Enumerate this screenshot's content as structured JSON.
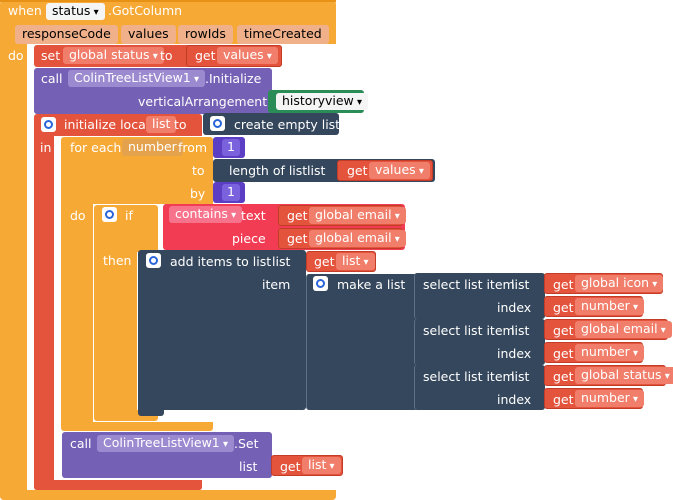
{
  "event": {
    "when": "when",
    "component": "status",
    "event_name": ".GotColumn",
    "do": "do",
    "params": [
      "responseCode",
      "values",
      "rowIds",
      "timeCreated"
    ]
  },
  "set_status": {
    "set": "set",
    "var": "global status",
    "to": "to",
    "get": "get",
    "value": "values"
  },
  "init_call": {
    "call": "call",
    "component": "ColinTreeListView1",
    "method": ".Initialize",
    "arg_label": "verticalArrangement",
    "arg_value": "historyview"
  },
  "local": {
    "label": "initialize local",
    "name": "list",
    "to": "to",
    "in": "in",
    "create": "create empty list"
  },
  "foreach": {
    "label": "for each",
    "var": "number",
    "from": "from",
    "from_value": "1",
    "to": "to",
    "length_label": "length of list",
    "list_label": "list",
    "get": "get",
    "values": "values",
    "by": "by",
    "by_value": "1",
    "do": "do"
  },
  "if_block": {
    "if": "if",
    "then": "then",
    "contains": "contains",
    "text_label": "text",
    "piece_label": "piece",
    "get": "get",
    "email": "global email"
  },
  "add_items": {
    "label": "add items to list",
    "list_label": "list",
    "get": "get",
    "list_var": "list",
    "item_label": "item",
    "make": "make a list"
  },
  "selects": [
    {
      "label": "select list item",
      "list_label": "list",
      "get": "get",
      "list_val": "global icon",
      "index_label": "index",
      "index_val": "number"
    },
    {
      "label": "select list item",
      "list_label": "list",
      "get": "get",
      "list_val": "global email",
      "index_label": "index",
      "index_val": "number"
    },
    {
      "label": "select list item",
      "list_label": "list",
      "get": "get",
      "list_val": "global status",
      "index_label": "index",
      "index_val": "number"
    }
  ],
  "set_call": {
    "call": "call",
    "component": "ColinTreeListView1",
    "method": ".Set",
    "list_label": "list",
    "get": "get",
    "value": "list"
  }
}
